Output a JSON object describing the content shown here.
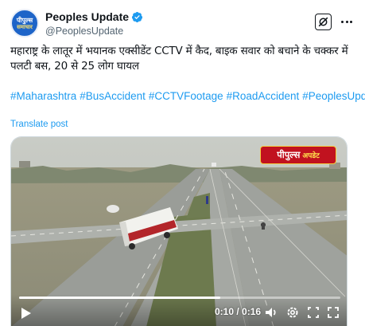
{
  "author": {
    "display_name": "Peoples Update",
    "handle": "@PeoplesUpdate",
    "avatar_text_top": "पीपुल्स",
    "avatar_text_bottom": "समाचार",
    "verified": true
  },
  "post": {
    "text": "महाराष्ट्र के लातूर में भयानक एक्सीडेंट CCTV में कैद, बाइक सवार को बचाने के चक्कर में पलटी बस, 20 से 25 लोग घायल",
    "hashtags": [
      "#Maharashtra",
      "#BusAccident",
      "#CCTVFootage",
      "#RoadAccident",
      "#PeoplesUpdate"
    ],
    "translate_label": "Translate post"
  },
  "video": {
    "watermark_main": "पीपुल्स",
    "watermark_sub": "अपडेट",
    "time_display": "0:10 / 0:16",
    "progress_fraction": 0.625
  },
  "icons": {
    "grok": "grok-icon",
    "more": "more-icon",
    "play": "play-icon",
    "volume": "volume-icon",
    "settings": "settings-icon",
    "fullscreen": "fullscreen-icon"
  },
  "colors": {
    "link": "#1d9bf0",
    "verified": "#1d9bf0",
    "watermark_bg": "#c1121f"
  }
}
